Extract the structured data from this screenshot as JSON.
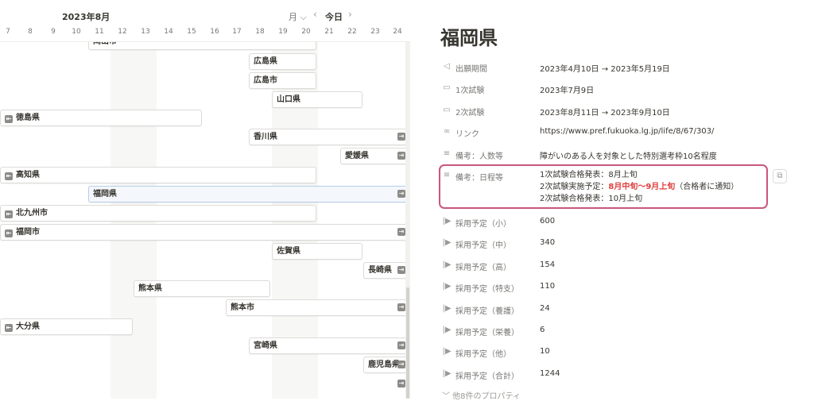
{
  "timeline": {
    "month_label": "2023年8月",
    "month_control": "月 ⌵",
    "prev_glyph": "‹",
    "today_label": "今日",
    "next_glyph": "›",
    "days": [
      "7",
      "8",
      "9",
      "10",
      "11",
      "12",
      "13",
      "14",
      "15",
      "16",
      "17",
      "18",
      "19",
      "20",
      "21",
      "22",
      "23",
      "24"
    ],
    "bars": [
      {
        "label": "岡山市"
      },
      {
        "label": "広島県"
      },
      {
        "label": "広島市"
      },
      {
        "label": "山口県"
      },
      {
        "label": "徳島県"
      },
      {
        "label": "香川県"
      },
      {
        "label": "愛媛県"
      },
      {
        "label": "高知県"
      },
      {
        "label": "福岡県"
      },
      {
        "label": "北九州市"
      },
      {
        "label": "福岡市"
      },
      {
        "label": "佐賀県"
      },
      {
        "label": "長崎県"
      },
      {
        "label": "熊本県"
      },
      {
        "label": "熊本市"
      },
      {
        "label": "大分県"
      },
      {
        "label": "宮崎県"
      },
      {
        "label": "鹿児島県"
      }
    ],
    "arrow_left_glyph": "⇤",
    "arrow_right_glyph": "⇥",
    "colors": {
      "weekend": "#f7f7f5",
      "selected_border": "#b7cdea"
    }
  },
  "panel": {
    "title": "福岡県",
    "properties": [
      {
        "icon": "paper-plane-icon",
        "glyph": "◁",
        "label": "出願期間",
        "value": "2023年4月10日 → 2023年5月19日"
      },
      {
        "icon": "calendar-icon",
        "glyph": "▭",
        "label": "1次試験",
        "value": "2023年7月9日"
      },
      {
        "icon": "calendar-icon",
        "glyph": "▭",
        "label": "2次試験",
        "value": "2023年8月11日 → 2023年9月10日"
      },
      {
        "icon": "link-icon",
        "glyph": "∞",
        "label": "リンク",
        "value": "https://www.pref.fukuoka.lg.jp/life/8/67/303/"
      },
      {
        "icon": "text-lines-icon",
        "glyph": "≡",
        "label": "備考：人数等",
        "value": "障がいのある人を対象とした特別選考枠10名程度"
      }
    ],
    "schedule_note": {
      "icon": "text-lines-icon",
      "glyph": "≡",
      "label": "備考：日程等",
      "line1": "1次試験合格発表：8月上旬",
      "line2_prefix": "2次試験実施予定：",
      "line2_highlight": "8月中旬〜9月上旬",
      "line2_suffix": "（合格者に通知）",
      "line3": "2次試験合格発表：10月上旬"
    },
    "copy_glyph": "⧉",
    "recruitment": [
      {
        "icon": "number-icon",
        "glyph": "|▶",
        "label": "採用予定（小）",
        "value": "600"
      },
      {
        "icon": "number-icon",
        "glyph": "|▶",
        "label": "採用予定（中）",
        "value": "340"
      },
      {
        "icon": "number-icon",
        "glyph": "|▶",
        "label": "採用予定（高）",
        "value": "154"
      },
      {
        "icon": "number-icon",
        "glyph": "|▶",
        "label": "採用予定（特支）",
        "value": "110"
      },
      {
        "icon": "number-icon",
        "glyph": "|▶",
        "label": "採用予定（養護）",
        "value": "24"
      },
      {
        "icon": "number-icon",
        "glyph": "|▶",
        "label": "採用予定（栄養）",
        "value": "6"
      },
      {
        "icon": "number-icon",
        "glyph": "|▶",
        "label": "採用予定（他）",
        "value": "10"
      },
      {
        "icon": "number-icon",
        "glyph": "|▶",
        "label": "採用予定（合計）",
        "value": "1244"
      }
    ],
    "more_props": "﹀ 他8件のプロパティ",
    "colors": {
      "highlight_border": "#c9577b",
      "red_text": "#e03e3e"
    }
  }
}
